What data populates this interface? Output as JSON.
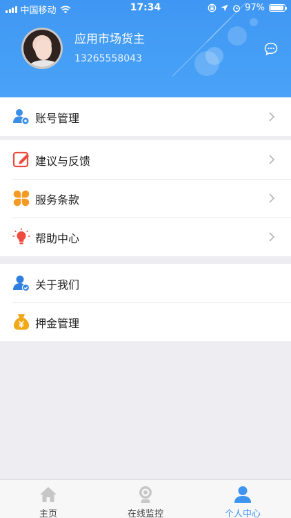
{
  "status_bar": {
    "carrier": "中国移动",
    "time": "17:34",
    "battery": "97%",
    "battery_level": 0.97
  },
  "profile": {
    "name": "应用市场货主",
    "phone": "13265558043"
  },
  "groups": [
    {
      "items": [
        {
          "label": "账号管理",
          "icon": "account-settings-icon"
        }
      ]
    },
    {
      "items": [
        {
          "label": "建议与反馈",
          "icon": "feedback-edit-icon"
        },
        {
          "label": "服务条款",
          "icon": "terms-grid-icon"
        },
        {
          "label": "帮助中心",
          "icon": "lightbulb-icon"
        }
      ]
    },
    {
      "items": [
        {
          "label": "关于我们",
          "icon": "about-user-icon"
        },
        {
          "label": "押金管理",
          "icon": "money-bag-icon"
        }
      ]
    }
  ],
  "tabbar": {
    "tabs": [
      {
        "label": "主页",
        "icon": "home-icon"
      },
      {
        "label": "在线监控",
        "icon": "camera-icon"
      },
      {
        "label": "个人中心",
        "icon": "person-icon",
        "active": true
      }
    ]
  },
  "colors": {
    "header_blue": "#4aa3f7",
    "active_tab": "#3e95f1",
    "feedback_red": "#e94b3c",
    "terms_orange": "#f59a23",
    "bulb_red": "#f04b3c",
    "about_blue": "#2f7fe0",
    "moneybag_gold": "#f0a817"
  }
}
